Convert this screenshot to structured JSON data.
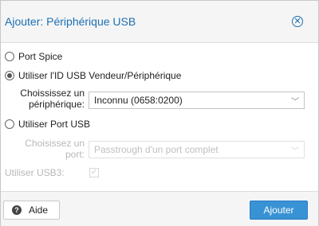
{
  "dialog": {
    "title": "Ajouter: Périphérique USB",
    "close_icon": "close-circle-icon"
  },
  "options": {
    "port_spice": {
      "label": "Port Spice",
      "checked": false
    },
    "usb_vendor": {
      "label": "Utiliser l'ID USB Vendeur/Périphérique",
      "checked": true
    },
    "usb_port": {
      "label": "Utiliser Port USB",
      "checked": false
    }
  },
  "device_select": {
    "label_line1": "Choississez un",
    "label_line2": "périphérique:",
    "value": "Inconnu (0658:0200)",
    "disabled": false
  },
  "port_select": {
    "label_line1": "Choisissez un",
    "label_line2": "port:",
    "value": "Passtrough d'un port complet",
    "disabled": true
  },
  "usb3": {
    "label": "Utiliser USB3:",
    "checked": true,
    "disabled": true
  },
  "footer": {
    "help_label": "Aide",
    "help_icon": "question-circle-icon",
    "submit_label": "Ajouter"
  },
  "colors": {
    "accent": "#1c6fb3",
    "primary_button": "#3892d4",
    "disabled_text": "#b8b8b8"
  }
}
